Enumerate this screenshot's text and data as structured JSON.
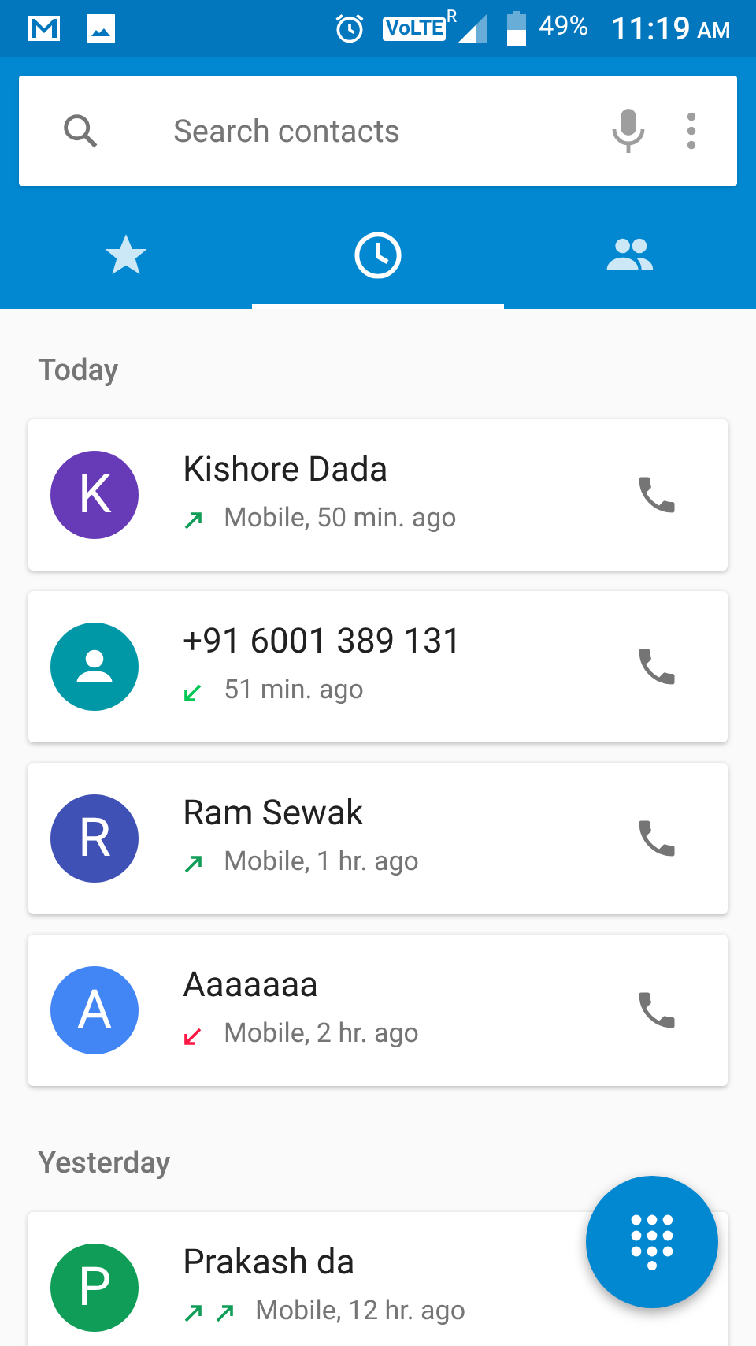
{
  "status_bar": {
    "volte": "VoLTE",
    "roaming": "R",
    "battery": "49%",
    "time": "11:19",
    "ampm": "AM"
  },
  "search": {
    "placeholder": "Search contacts"
  },
  "tabs": [
    {
      "kind": "favorites",
      "selected": false
    },
    {
      "kind": "recents",
      "selected": true
    },
    {
      "kind": "contacts",
      "selected": false
    }
  ],
  "sections": [
    {
      "title": "Today",
      "calls": [
        {
          "kind": "letter",
          "avatar": "K",
          "color": "#673ab7",
          "name": "Kishore Dada",
          "call_types": [
            {
              "kind": "outgoing"
            }
          ],
          "detail": "Mobile, 50 min. ago"
        },
        {
          "kind": "person",
          "color": "#0097a7",
          "name": "+91 6001 389 131",
          "call_types": [
            {
              "kind": "incoming"
            }
          ],
          "detail": "51 min. ago"
        },
        {
          "kind": "letter",
          "avatar": "R",
          "color": "#3f51b5",
          "name": "Ram Sewak",
          "call_types": [
            {
              "kind": "outgoing"
            }
          ],
          "detail": "Mobile, 1 hr. ago"
        },
        {
          "kind": "letter",
          "avatar": "A",
          "color": "#4285f4",
          "name": "Aaaaaaa",
          "call_types": [
            {
              "kind": "missed"
            }
          ],
          "detail": "Mobile, 2 hr. ago"
        }
      ]
    },
    {
      "title": "Yesterday",
      "calls": [
        {
          "kind": "letter",
          "avatar": "P",
          "color": "#0f9d58",
          "name": "Prakash da",
          "call_types": [
            {
              "kind": "outgoing"
            },
            {
              "kind": "outgoing"
            }
          ],
          "detail": "Mobile, 12 hr. ago"
        }
      ]
    }
  ]
}
